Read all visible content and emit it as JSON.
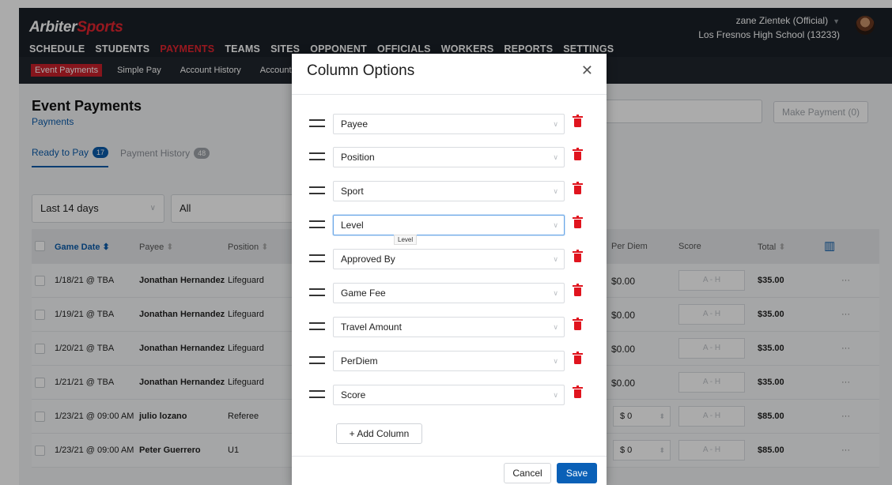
{
  "brand": {
    "part1": "Arbiter",
    "part2": "Sports"
  },
  "nav": [
    "SCHEDULE",
    "STUDENTS",
    "PAYMENTS",
    "TEAMS",
    "SITES",
    "OPPONENT",
    "OFFICIALS",
    "WORKERS",
    "REPORTS",
    "SETTINGS"
  ],
  "nav_active": "PAYMENTS",
  "user": {
    "name": "zane Zientek (Official)",
    "school": "Los Fresnos High School (13233)"
  },
  "subnav": [
    "Event Payments",
    "Simple Pay",
    "Account History",
    "Accounts"
  ],
  "page": {
    "title": "Event Payments",
    "crumb": "Payments",
    "make_payment": "Make Payment (0)"
  },
  "tabs": [
    {
      "label": "Ready to Pay",
      "count": "17"
    },
    {
      "label": "Payment History",
      "count": "48"
    }
  ],
  "filters": {
    "range": "Last 14 days",
    "scope": "All"
  },
  "table": {
    "headers": {
      "game_date": "Game Date",
      "payee": "Payee",
      "position": "Position",
      "per_diem": "Per Diem",
      "score": "Score",
      "total": "Total"
    },
    "score_placeholder": "A  -  H",
    "rows": [
      {
        "date": "1/18/21 @ TBA",
        "payee": "Jonathan Hernandez",
        "position": "Lifeguard",
        "per_diem": "$0.00",
        "total": "$35.00"
      },
      {
        "date": "1/19/21 @ TBA",
        "payee": "Jonathan Hernandez",
        "position": "Lifeguard",
        "per_diem": "$0.00",
        "total": "$35.00"
      },
      {
        "date": "1/20/21 @ TBA",
        "payee": "Jonathan Hernandez",
        "position": "Lifeguard",
        "per_diem": "$0.00",
        "total": "$35.00"
      },
      {
        "date": "1/21/21 @ TBA",
        "payee": "Jonathan Hernandez",
        "position": "Lifeguard",
        "per_diem": "$0.00",
        "total": "$35.00"
      },
      {
        "date": "1/23/21 @ 09:00 AM",
        "payee": "julio lozano",
        "position": "Referee",
        "per_diem": "$ 0",
        "total": "$85.00"
      },
      {
        "date": "1/23/21 @ 09:00 AM",
        "payee": "Peter Guerrero",
        "position": "U1",
        "per_diem": "$ 0",
        "total": "$85.00"
      }
    ]
  },
  "modal": {
    "title": "Column Options",
    "columns": [
      "Payee",
      "Position",
      "Sport",
      "Level",
      "Approved By",
      "Game Fee",
      "Travel Amount",
      "PerDiem",
      "Score"
    ],
    "tooltip": "Level",
    "add_column": "+ Add Column",
    "cancel": "Cancel",
    "save": "Save"
  }
}
